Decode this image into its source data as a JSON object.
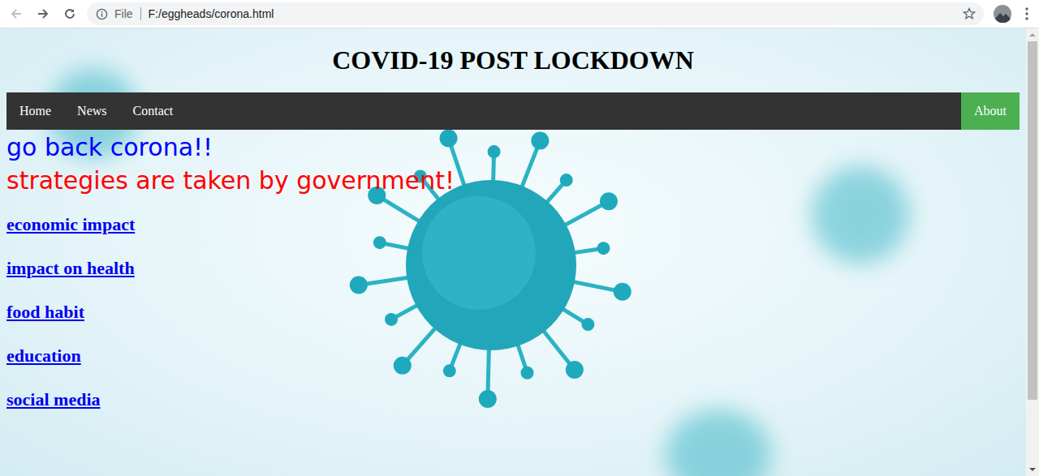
{
  "browser": {
    "scheme": "File",
    "url": "F:/eggheads/corona.html"
  },
  "page": {
    "title": "COVID-19 POST LOCKDOWN",
    "nav": [
      {
        "label": "Home",
        "kind": "link"
      },
      {
        "label": "News",
        "kind": "link"
      },
      {
        "label": "Contact",
        "kind": "link"
      },
      {
        "label": "About",
        "kind": "accent"
      }
    ],
    "headline": "go back corona!!",
    "subheadline": "strategies are taken by government!",
    "topics": [
      "economic impact",
      "impact on health",
      "food habit",
      "education",
      "social media"
    ]
  },
  "scrollbar": {
    "level": 0.85
  }
}
